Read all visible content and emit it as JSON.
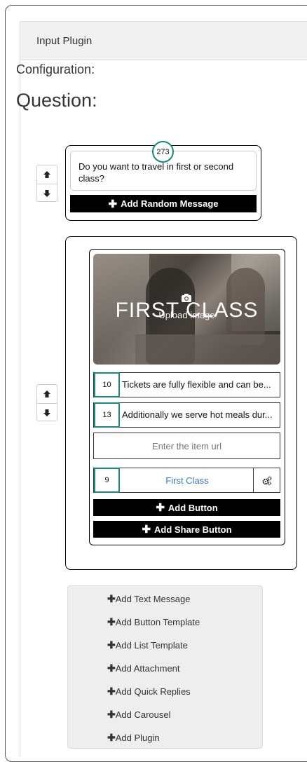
{
  "panel": {
    "title": "Input Plugin"
  },
  "configuration_label": "Configuration:",
  "question_label": "Question:",
  "message_card": {
    "counter": "273",
    "text": "Do you want to travel in first or second class?",
    "add_random_label": "Add Random Message"
  },
  "generic_card": {
    "image_title": "FIRST CLASS",
    "upload_label": "Upload image",
    "title_row": {
      "count": "10",
      "text": "Tickets are fully flexible and can be..."
    },
    "subtitle_row": {
      "count": "13",
      "text": "Additionally we serve hot meals dur..."
    },
    "url_placeholder": "Enter the item url",
    "button_row": {
      "count": "9",
      "label": "First Class"
    },
    "add_button_label": "Add Button",
    "add_share_button_label": "Add Share Button"
  },
  "add_menu": {
    "items": [
      "Add Text Message",
      "Add Button Template",
      "Add List Template",
      "Add Attachment",
      "Add Quick Replies",
      "Add Carousel",
      "Add Plugin"
    ]
  },
  "colors": {
    "accent_teal": "#1a8a7a",
    "link_blue": "#3a78c9",
    "button_black": "#000000"
  },
  "icons": [
    "arrow-up-icon",
    "arrow-down-icon",
    "plus-icon",
    "camera-icon",
    "gears-icon"
  ]
}
